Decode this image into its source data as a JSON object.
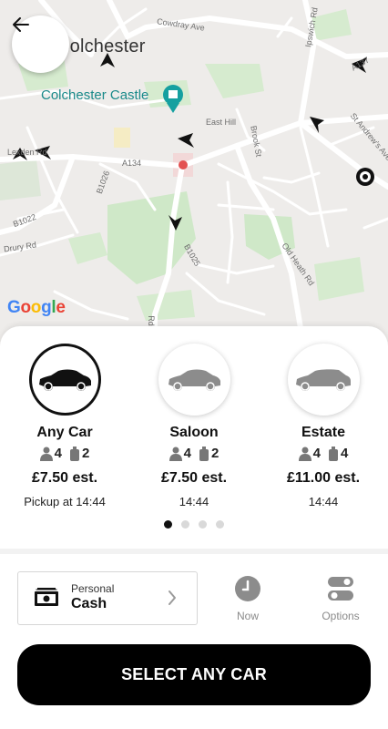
{
  "map": {
    "place_labels": {
      "city": "Colchester",
      "castle": "Colchester Castle",
      "cowdray_ave": "Cowdray Ave",
      "ipswich_rd": "Ipswich Rd",
      "east_hill": "East Hill",
      "st_andrews_ave": "St Andrew's Ave",
      "brook_st": "Brook St",
      "a134": "A134",
      "a133": "A133",
      "b1026": "B1026",
      "b1022": "B1022",
      "b1025": "B1025",
      "lexden_rd": "Lexden Rd",
      "drury_rd": "Drury Rd",
      "old_heath_rd": "Old Heath Rd",
      "rd_bottom": "Rd",
      "a137": "A137"
    },
    "google_logo": [
      "G",
      "o",
      "o",
      "g",
      "l",
      "e"
    ],
    "google_colors": [
      "#4285F4",
      "#EA4335",
      "#FBBC05",
      "#4285F4",
      "#34A853",
      "#EA4335"
    ]
  },
  "back_button_icon": "back-arrow-icon",
  "vehicles": [
    {
      "name": "Any Car",
      "passengers": "4",
      "luggage": "2",
      "price": "£7.50 est.",
      "pickup": "Pickup at 14:44",
      "selected": true
    },
    {
      "name": "Saloon",
      "passengers": "4",
      "luggage": "2",
      "price": "£7.50 est.",
      "pickup": "14:44",
      "selected": false
    },
    {
      "name": "Estate",
      "passengers": "4",
      "luggage": "4",
      "price": "£11.00 est.",
      "pickup": "14:44",
      "selected": false
    }
  ],
  "pagination": {
    "count": 4,
    "active": 0
  },
  "payment": {
    "type": "Personal",
    "method": "Cash",
    "icon": "cash-icon"
  },
  "time_button": {
    "label": "Now",
    "icon": "clock-icon"
  },
  "options_button": {
    "label": "Options",
    "icon": "toggles-icon"
  },
  "primary_action": {
    "label": "SELECT ANY CAR"
  },
  "colors": {
    "accent": "#000000",
    "selected_car": "#111111",
    "unselected_car": "#8c8c8c",
    "muted_label": "#8a8a8a"
  }
}
